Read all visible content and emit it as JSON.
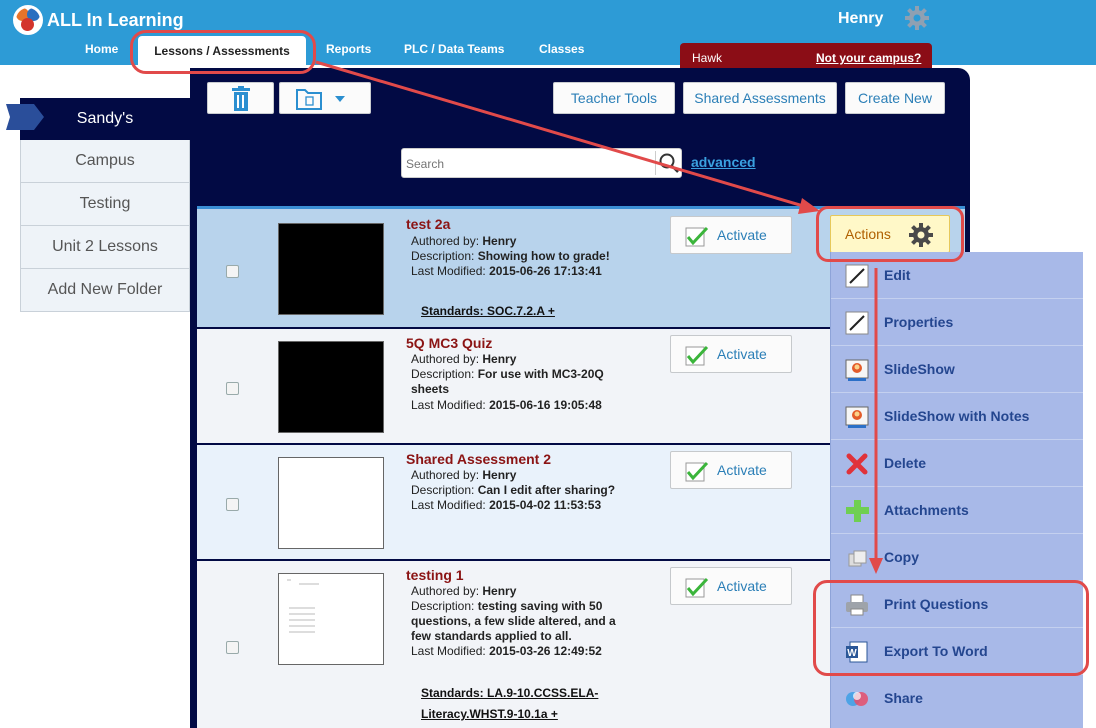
{
  "app": {
    "title": "ALL In Learning",
    "user": "Henry"
  },
  "nav": {
    "home": "Home",
    "lessons": "Lessons / Assessments",
    "reports": "Reports",
    "plc": "PLC / Data Teams",
    "classes": "Classes"
  },
  "campus": {
    "name": "Hawk",
    "link": "Not your campus?"
  },
  "sidebar": {
    "items": [
      {
        "label": "Sandy's"
      },
      {
        "label": "Campus"
      },
      {
        "label": "Testing"
      },
      {
        "label": "Unit 2 Lessons"
      },
      {
        "label": "Add New Folder"
      }
    ]
  },
  "toolbar": {
    "teacher_tools": "Teacher Tools",
    "shared_assessments": "Shared Assessments",
    "create_new": "Create New"
  },
  "search": {
    "placeholder": "Search",
    "advanced": "advanced"
  },
  "list": {
    "authored_label": "Authored by:",
    "description_label": "Description:",
    "modified_label": "Last Modified:",
    "activate_label": "Activate",
    "items": [
      {
        "title": "test 2a",
        "author": "Henry",
        "description": "Showing how to grade!",
        "modified": "2015-06-26 17:13:41",
        "standards": "Standards: SOC.7.2.A +"
      },
      {
        "title": "5Q MC3 Quiz",
        "author": "Henry",
        "description": "For use with MC3-20Q sheets",
        "modified": "2015-06-16 19:05:48"
      },
      {
        "title": "Shared Assessment 2",
        "author": "Henry",
        "description": "Can I edit after sharing?",
        "modified": "2015-04-02 11:53:53"
      },
      {
        "title": "testing 1",
        "author": "Henry",
        "description": "testing saving with 50 questions, a few slide altered, and a few standards applied to all.",
        "modified": "2015-03-26 12:49:52",
        "standards": "Standards: LA.9-10.CCSS.ELA-Literacy.WHST.9-10.1a +"
      }
    ]
  },
  "actions": {
    "label": "Actions",
    "menu": [
      {
        "label": "Edit",
        "icon": "pencil-icon"
      },
      {
        "label": "Properties",
        "icon": "pencil-icon"
      },
      {
        "label": "SlideShow",
        "icon": "slideshow-icon"
      },
      {
        "label": "SlideShow with Notes",
        "icon": "slideshow-icon"
      },
      {
        "label": "Delete",
        "icon": "red-x-icon"
      },
      {
        "label": "Attachments",
        "icon": "green-plus-icon"
      },
      {
        "label": "Copy",
        "icon": "copy-icon"
      },
      {
        "label": "Print Questions",
        "icon": "printer-icon"
      },
      {
        "label": "Export To Word",
        "icon": "word-icon"
      },
      {
        "label": "Share",
        "icon": "share-icon"
      }
    ]
  },
  "colors": {
    "topbar": "#2d9bd6",
    "panel": "#020a44",
    "campus_bar": "#8b0d16",
    "menu": "#a8b9e8",
    "annotation": "#e14a4a"
  }
}
